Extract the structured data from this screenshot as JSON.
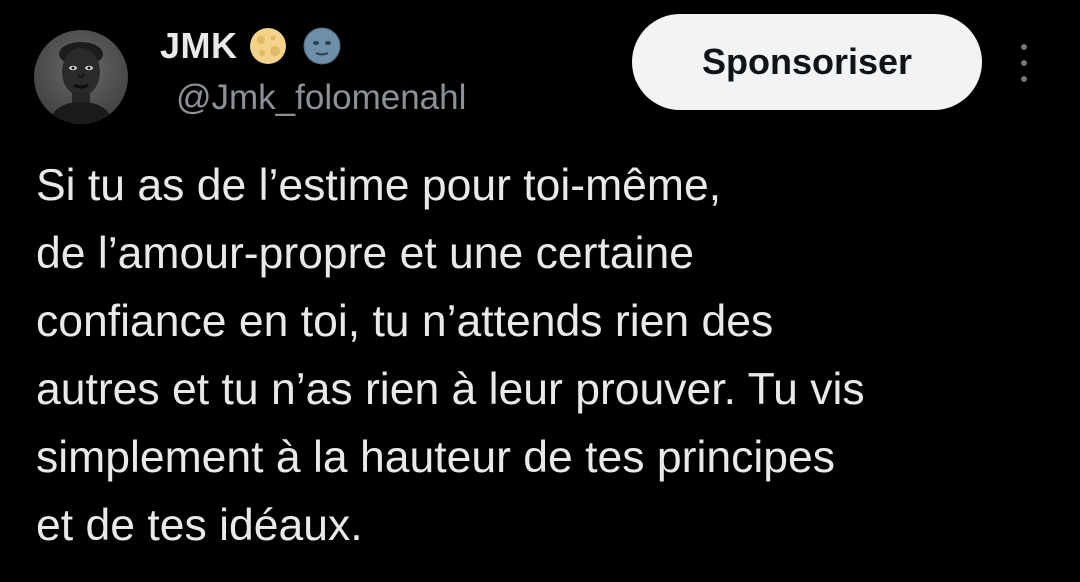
{
  "author": {
    "display_name": "JMK",
    "handle": "@Jmk_folomenahl",
    "emojis": [
      "full-moon-emoji",
      "new-moon-face-emoji"
    ]
  },
  "actions": {
    "sponsor_label": "Sponsoriser",
    "more_icon": "more-vertical-icon"
  },
  "tweet": {
    "lines": [
      "Si tu as de l’estime pour toi-même,",
      "de l’amour-propre et une certaine",
      "confiance en toi, tu n’attends rien des",
      "autres et tu n’as rien à leur prouver. Tu vis",
      "simplement à la hauteur de tes principes",
      "et de tes idéaux."
    ]
  },
  "colors": {
    "background": "#000000",
    "text_primary": "#e7e9ea",
    "text_secondary": "#8b9196",
    "button_bg": "#f2f3f4",
    "button_text": "#0f1419"
  }
}
